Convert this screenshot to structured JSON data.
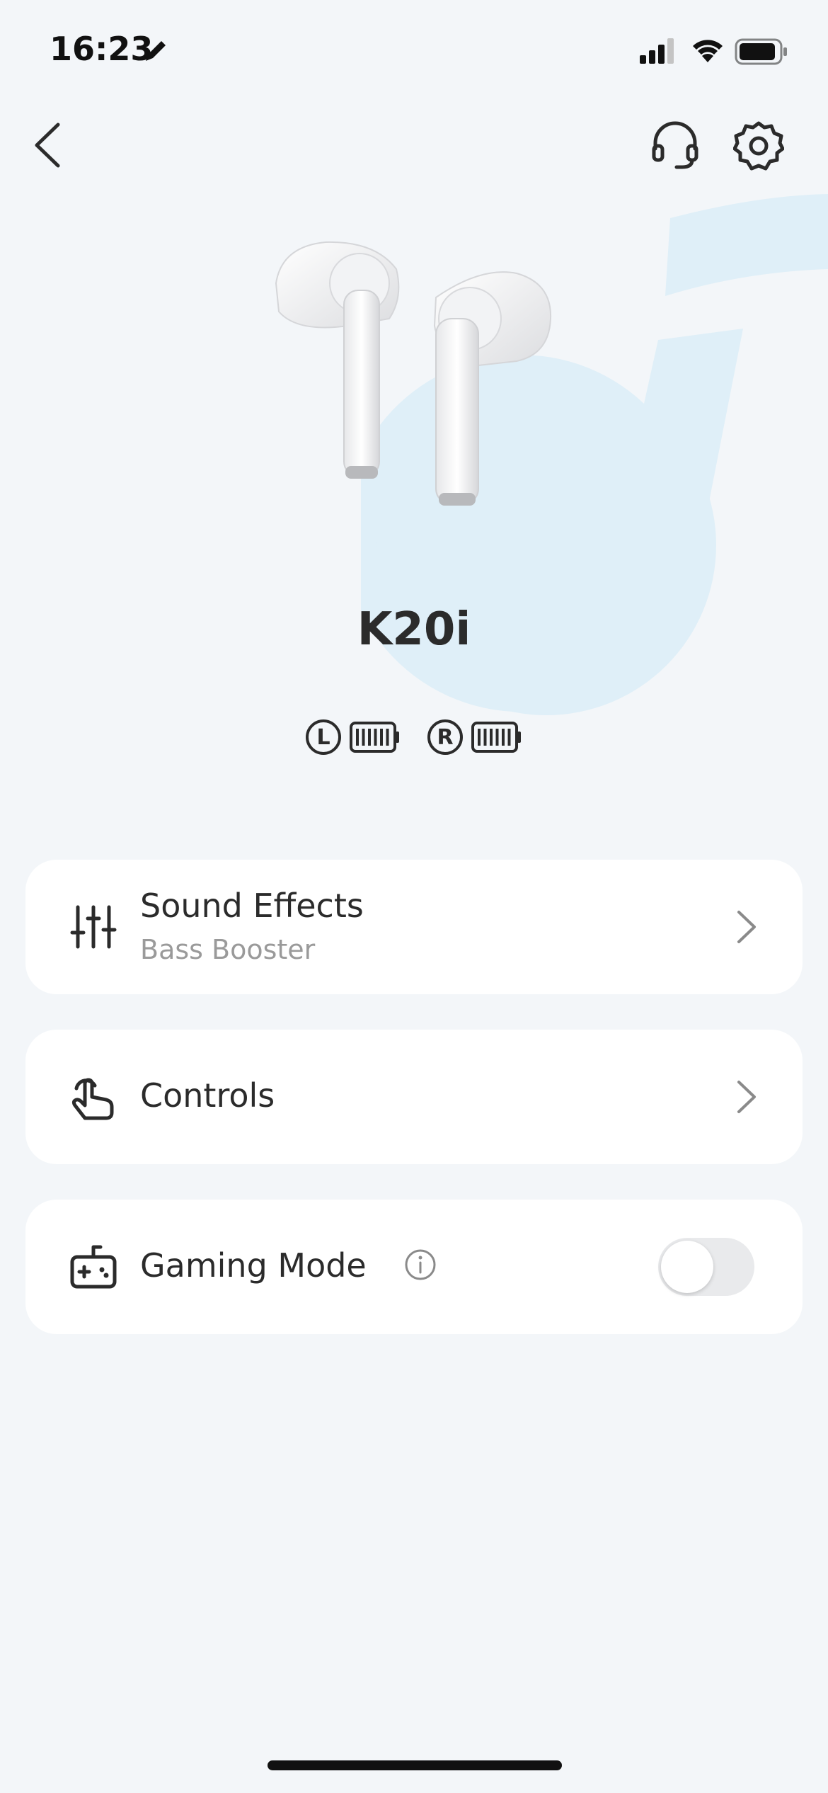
{
  "status_bar": {
    "time": "16:23",
    "icons": [
      "pencil-icon",
      "signal-icon",
      "wifi-icon",
      "battery-icon"
    ]
  },
  "nav": {
    "back_icon": "chevron-left-icon",
    "support_icon": "headset-icon",
    "settings_icon": "gear-icon"
  },
  "device": {
    "name": "K20i",
    "left_label": "L",
    "right_label": "R",
    "left_battery_level": 1.0,
    "right_battery_level": 1.0
  },
  "cards": {
    "sound_effects": {
      "title": "Sound Effects",
      "subtitle": "Bass Booster",
      "icon": "equalizer-icon"
    },
    "controls": {
      "title": "Controls",
      "icon": "touch-hand-icon"
    },
    "gaming_mode": {
      "title": "Gaming Mode",
      "icon": "gamepad-icon",
      "enabled": false
    }
  },
  "colors": {
    "background": "#f3f6f9",
    "card": "#ffffff",
    "text": "#2b2b2b",
    "subtext": "#9a9a9a",
    "accent_logo": "#dfeff8",
    "toggle_off": "#e9eaec"
  }
}
